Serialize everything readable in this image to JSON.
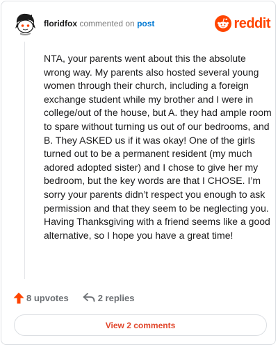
{
  "comment": {
    "author": "floridfox",
    "action_text": "commented on",
    "post_link": "post",
    "body": "NTA, your parents went about this the absolute wrong way. My parents also hosted several young women through their church, including a foreign exchange student while my brother and I were in college/out of the house, but A. they had ample room to spare without turning us out of our bedrooms, and B. They ASKED us if it was okay! One of the girls turned out to be a permanent resident (my much adored adopted sister) and I chose to give her my bedroom, but the key words are that I CHOSE. I’m sorry your parents didn’t respect you enough to ask permission and that they seem to be neglecting you. Having Thanksgiving with a friend seems like a good alternative, so I hope you have a great time!"
  },
  "brand": {
    "name": "reddit",
    "color": "#ff4500"
  },
  "actions": {
    "upvotes": "8 upvotes",
    "replies": "2 replies",
    "upvote_color": "#ff4500"
  },
  "footer": {
    "view_comments": "View 2 comments",
    "link_color": "#e1472c"
  },
  "icons": {
    "avatar": "snoo-avatar-icon",
    "brand_logo": "reddit-logo-icon",
    "upvote": "upvote-arrow-icon",
    "reply": "reply-arrow-icon"
  }
}
